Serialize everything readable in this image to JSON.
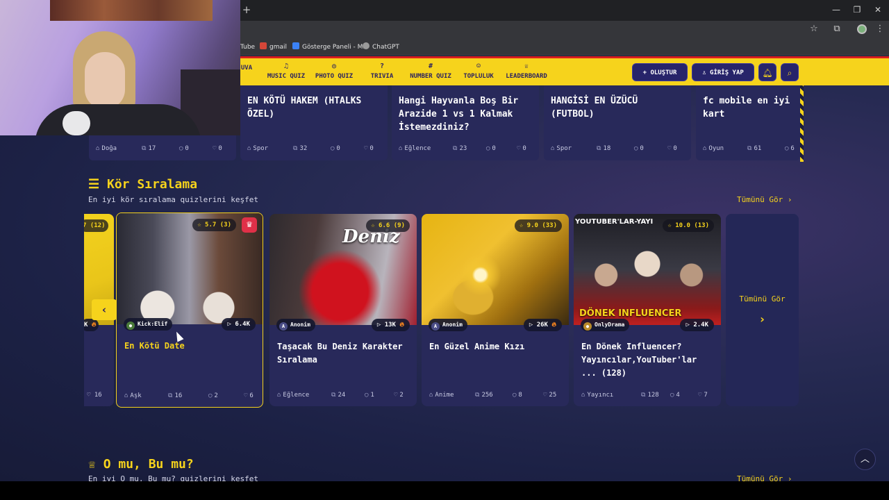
{
  "browser": {
    "new_tab": "+",
    "window_controls": [
      "—",
      "❐",
      "✕"
    ],
    "bookmarks": [
      {
        "label": "Tube",
        "color": "#cc2020"
      },
      {
        "label": "gmail",
        "color": "#d44638"
      },
      {
        "label": "Gösterge Paneli - M...",
        "color": "#3b82f6"
      },
      {
        "label": "ChatGPT",
        "color": "#9a9a9a"
      }
    ]
  },
  "nav": {
    "items": [
      {
        "icon": "",
        "label": "UVA"
      },
      {
        "icon": "♫",
        "label": "MUSIC QUIZ"
      },
      {
        "icon": "◎",
        "label": "PHOTO QUIZ"
      },
      {
        "icon": "?",
        "label": "TRIVIA"
      },
      {
        "icon": "#",
        "label": "NUMBER QUIZ"
      },
      {
        "icon": "☺",
        "label": "TOPLULUK"
      },
      {
        "icon": "♕",
        "label": "LEADERBOARD"
      }
    ],
    "create_label": "+ OLUŞTUR",
    "login_label": "GİRİŞ YAP"
  },
  "top_cards": [
    {
      "title": "",
      "category": "Doğa",
      "questions": "17",
      "comments": "0",
      "likes": "0"
    },
    {
      "title": "EN KÖTÜ HAKEM (HTALKS ÖZEL)",
      "category": "Spor",
      "questions": "32",
      "comments": "0",
      "likes": "0"
    },
    {
      "title": "Hangi Hayvanla Boş Bir Arazide 1 vs 1 Kalmak İstemezdiniz?",
      "category": "Eğlence",
      "questions": "23",
      "comments": "0",
      "likes": "0"
    },
    {
      "title": "HANGİSİ EN ÜZÜCÜ (FUTBOL)",
      "category": "Spor",
      "questions": "18",
      "comments": "0",
      "likes": "0"
    },
    {
      "title": "fc mobile en iyi kart",
      "category": "Oyun",
      "questions": "61",
      "comments": "6",
      "likes": ""
    }
  ],
  "section_blind": {
    "icon": "☰",
    "title": "Kör Sıralama",
    "subtitle": "En iyi kör sıralama quizlerini keşfet",
    "see_all": "Tümünü Gör ›"
  },
  "partial_left_card": {
    "rating": "7 (12)",
    "plays": "K",
    "likes": "16"
  },
  "quiz_cards": [
    {
      "rating": "☆ 5.7 (3)",
      "crown": true,
      "author": "Kick:Elif",
      "plays": "6.4K",
      "hot": false,
      "title": "En Kötü Date",
      "category": "Aşk",
      "questions": "16",
      "comments": "2",
      "likes": "6",
      "colors": [
        "#6b4a3a",
        "#a4a6b0",
        "#e8e0d8"
      ]
    },
    {
      "rating": "☆ 6.6 (9)",
      "crown": false,
      "author": "Anonim",
      "plays": "13K",
      "hot": true,
      "title": "Taşacak Bu Deniz Karakter Sıralama",
      "category": "Eğlence",
      "questions": "24",
      "comments": "1",
      "likes": "2",
      "image_text": "Deniz",
      "colors": [
        "#3a2f36",
        "#c4142a",
        "#8a8a92"
      ]
    },
    {
      "rating": "☆ 9.0 (33)",
      "crown": false,
      "author": "Anonim",
      "plays": "26K",
      "hot": true,
      "title": "En Güzel Anime Kızı",
      "category": "Anime",
      "questions": "256",
      "comments": "8",
      "likes": "25",
      "colors": [
        "#d49a10",
        "#f3c531",
        "#3a2a10"
      ]
    },
    {
      "rating": "☆ 10.0 (13)",
      "crown": false,
      "author": "OnlyDrama",
      "plays": "2.4K",
      "hot": false,
      "title": "En Dönek Influencer? Yayıncılar,YouTuber'lar ... (128)",
      "category": "Yayıncı",
      "questions": "128",
      "comments": "4",
      "likes": "7",
      "image_text": "YOUTUBER'LAR-YAYI",
      "image_text_bottom": "DÖNEK INFLUENCER",
      "colors": [
        "#2a2a30",
        "#b01818",
        "#f0f0f0"
      ]
    }
  ],
  "see_all_card": {
    "label": "Tümünü Gör",
    "arrow": "›"
  },
  "section_this_or_that": {
    "icon": "♕",
    "title": "O mu, Bu mu?",
    "subtitle": "En iyi O mu, Bu mu? quizlerini keşfet",
    "see_all": "Tümünü Gör ›"
  },
  "accent": "#f6d31c",
  "nav_bg": "#27246a"
}
